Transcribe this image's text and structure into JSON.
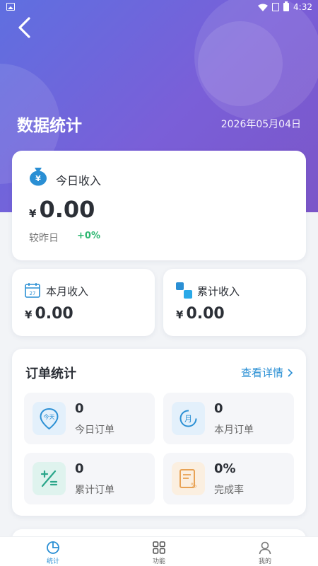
{
  "status_bar": {
    "time": "4:32"
  },
  "header": {
    "title": "数据统计",
    "date": "2026年05月04日"
  },
  "today_income": {
    "label": "今日收入",
    "currency": "¥",
    "amount": "0.00",
    "compare_label": "较昨日",
    "compare_value": "+0%"
  },
  "month_income": {
    "label": "本月收入",
    "currency": "¥",
    "amount": "0.00",
    "calendar_day": "27"
  },
  "total_income": {
    "label": "累计收入",
    "currency": "¥",
    "amount": "0.00"
  },
  "orders": {
    "title": "订单统计",
    "more_label": "查看详情",
    "tiles": [
      {
        "value": "0",
        "label": "今日订单",
        "icon_text": "今天"
      },
      {
        "value": "0",
        "label": "本月订单",
        "icon_text": "月"
      },
      {
        "value": "0",
        "label": "累计订单"
      },
      {
        "value": "0%",
        "label": "完成率",
        "icon_text": "%"
      }
    ]
  },
  "bottom_nav": [
    {
      "label": "统计",
      "active": true
    },
    {
      "label": "功能",
      "active": false
    },
    {
      "label": "我的",
      "active": false
    }
  ],
  "colors": {
    "accent": "#2a8fd4",
    "positive": "#2eb872",
    "hero_start": "#5f6fe0",
    "hero_end": "#7b56c8"
  }
}
